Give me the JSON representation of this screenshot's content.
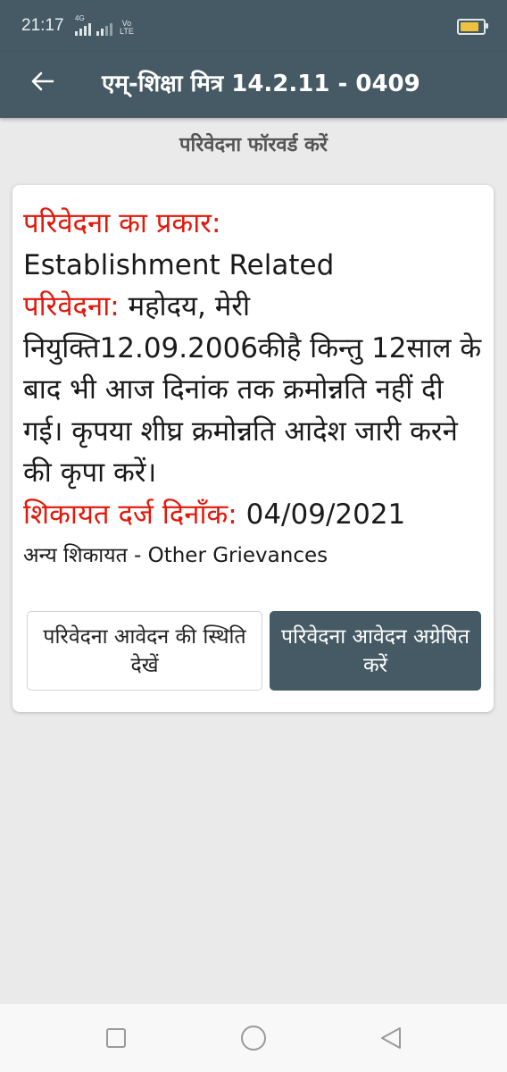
{
  "status_bar": {
    "time": "21:17",
    "network_tag": "4G",
    "volte_line1": "Vo",
    "volte_line2": "LTE",
    "battery_level": 0.85,
    "battery_color": "#f0c23b"
  },
  "app_bar": {
    "back_icon": "arrow-left-icon",
    "title": "एम्-शिक्षा मित्र 14.2.11 - 0409"
  },
  "sub_header": "परिवेदना फॉरवर्ड करें",
  "card": {
    "type_label": "परिवेदना का प्रकार:",
    "type_value": "Establishment Related",
    "grievance_label": "परिवेदना:",
    "grievance_text": "महोदय, मेरी नियुक्ति12.09.2006कीहै किन्तु 12साल के बाद भी आज दिनांक तक क्रमोन्नति नहीं दी गई। कृपया शीघ्र क्रमोन्नति आदेश जारी करने की कृपा करें।",
    "date_label": "शिकायत दर्ज दिनाँक:",
    "date_value": "04/09/2021",
    "category": "अन्य शिकायत - Other Grievances",
    "button_status_label": "परिवेदना आवेदन की स्थिति देखें",
    "button_forward_label": "परिवेदना आवेदन अग्रेषित करें"
  },
  "nav_bar": {
    "recents_icon": "square-icon",
    "home_icon": "circle-icon",
    "back_icon": "triangle-back-icon"
  },
  "colors": {
    "primary": "#455a64",
    "label_red": "#e3170a",
    "background": "#ebeaea"
  }
}
